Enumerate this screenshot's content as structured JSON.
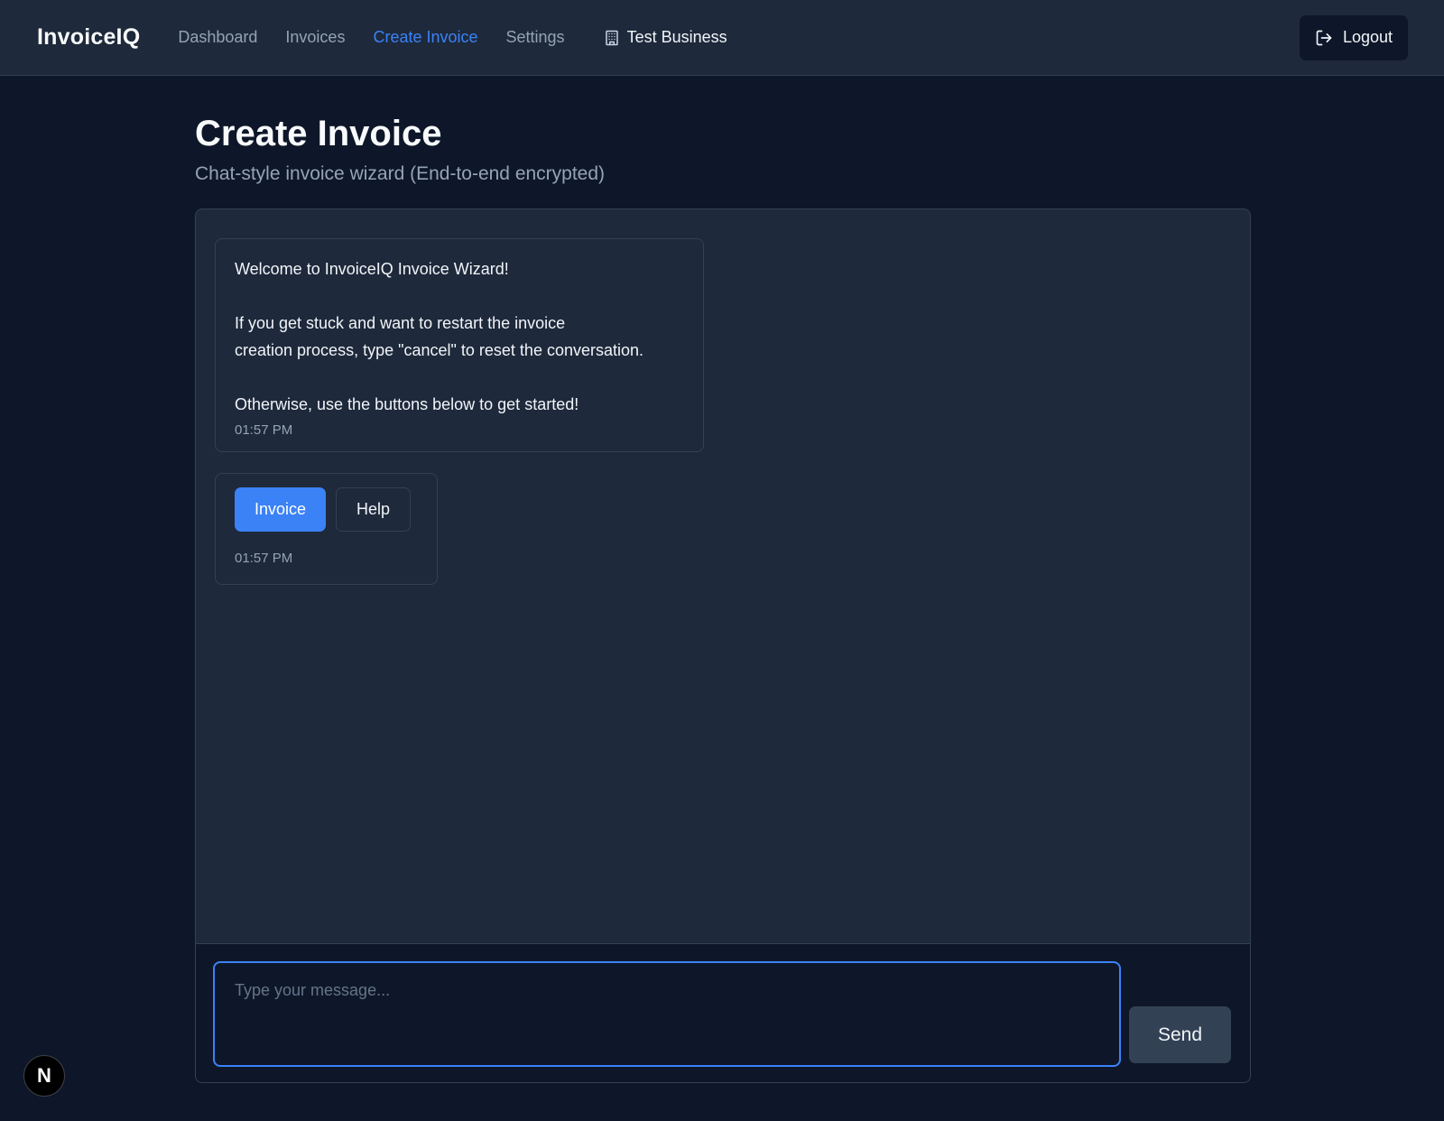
{
  "nav": {
    "brand": "InvoiceIQ",
    "links": [
      {
        "label": "Dashboard",
        "active": false
      },
      {
        "label": "Invoices",
        "active": false
      },
      {
        "label": "Create Invoice",
        "active": true
      },
      {
        "label": "Settings",
        "active": false
      }
    ],
    "business_name": "Test Business",
    "business_icon": "building-icon",
    "logout_label": "Logout",
    "logout_icon": "logout-icon"
  },
  "page": {
    "title": "Create Invoice",
    "subtitle": "Chat-style invoice wizard (End-to-end encrypted)"
  },
  "chat": {
    "welcome_message": {
      "paragraphs": [
        "Welcome to InvoiceIQ Invoice Wizard!",
        "If you get stuck and want to restart the invoice\ncreation process, type \"cancel\" to reset the conversation.",
        "Otherwise, use the buttons below to get started!"
      ],
      "time": "01:57 PM"
    },
    "action_message": {
      "primary_label": "Invoice",
      "secondary_label": "Help",
      "time": "01:57 PM"
    },
    "composer": {
      "placeholder": "Type your message...",
      "value": "",
      "send_label": "Send"
    }
  },
  "dev_badge": {
    "label": "N"
  },
  "colors": {
    "background": "#0e1729",
    "surface": "#1e293b",
    "border": "#334155",
    "accent": "#3b82f6",
    "muted_text": "#94a3b8",
    "text": "#f1f5f9"
  }
}
